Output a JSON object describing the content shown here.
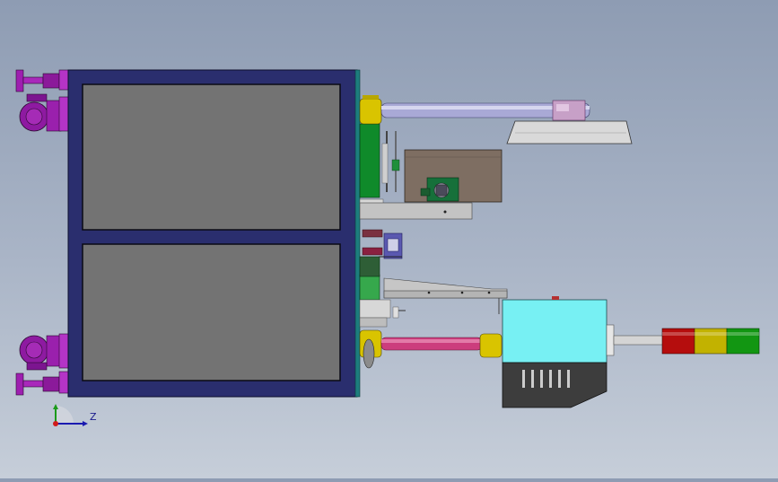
{
  "triad": {
    "z_label": "Z"
  },
  "colors": {
    "frame": "#2a2e6e",
    "panel": "#727272",
    "feet": "#9e1fb0",
    "cabinet": "#77f0f3",
    "rod": "#cc3d7d",
    "brass": "#d9c400",
    "light_red": "#b50d0d",
    "light_yellow": "#c2b200",
    "light_green": "#129612"
  }
}
